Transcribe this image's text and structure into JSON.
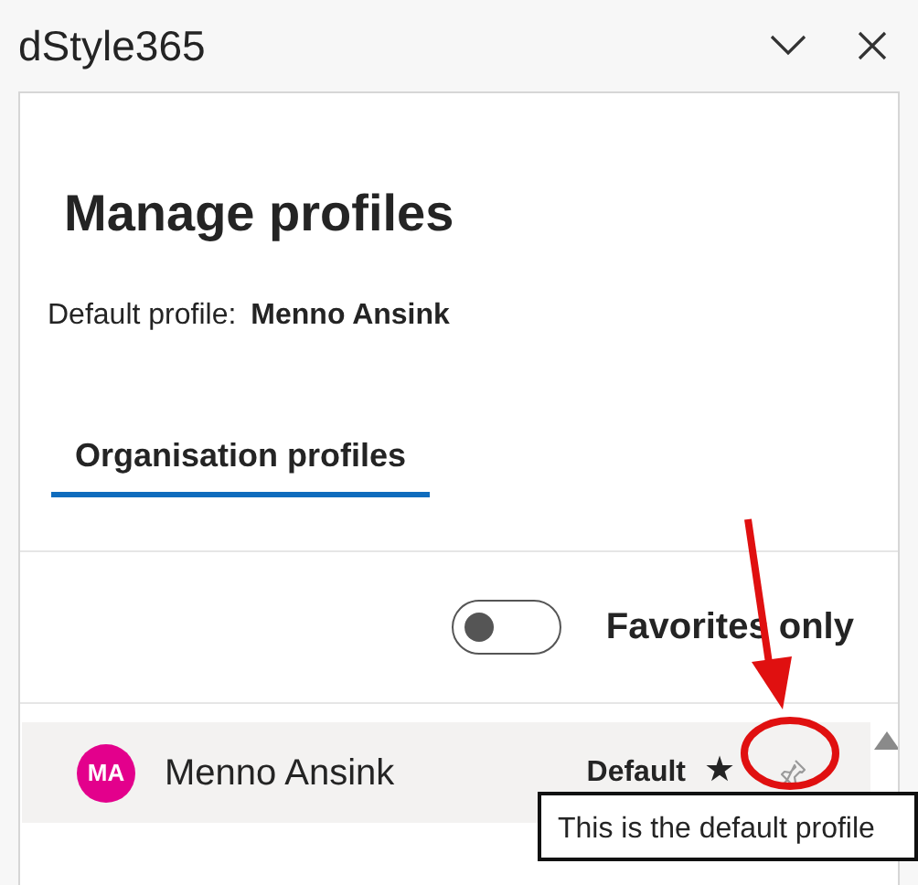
{
  "app": {
    "title": "dStyle365"
  },
  "heading": "Manage profiles",
  "default_profile": {
    "label": "Default profile:",
    "value": "Menno Ansink"
  },
  "tabs": [
    {
      "label": "Organisation profiles",
      "selected": true
    }
  ],
  "favorites_toggle": {
    "label": "Favorites only",
    "on": false
  },
  "profiles": [
    {
      "initials": "MA",
      "name": "Menno Ansink",
      "color": "#e3008c",
      "selected": true,
      "badge": "Default",
      "star": "★",
      "tooltip": "This is the default profile"
    }
  ]
}
